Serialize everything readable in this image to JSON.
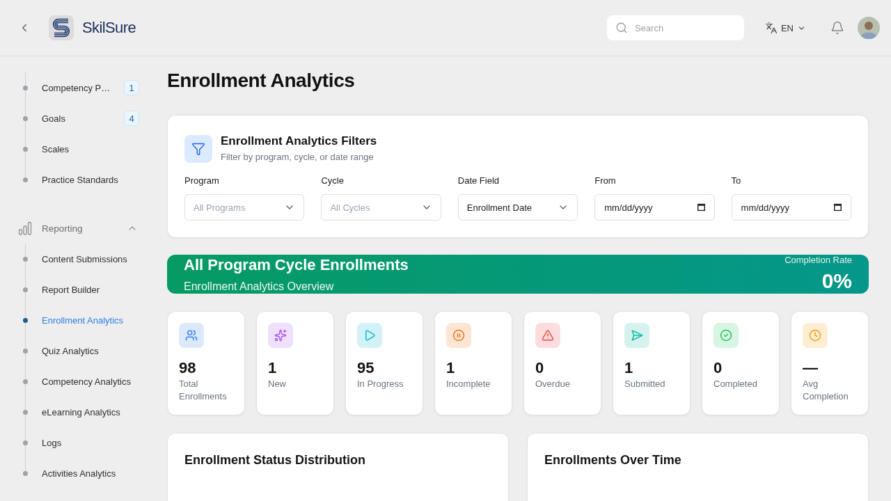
{
  "header": {
    "brand": "SkilSure",
    "search": {
      "placeholder": "Search"
    },
    "language": "EN"
  },
  "sidebar": {
    "groups": [
      {
        "items": [
          {
            "label": "Competency P…",
            "selected": false,
            "badge": "1"
          },
          {
            "label": "Goals",
            "selected": false,
            "badge": "4"
          },
          {
            "label": "Scales",
            "selected": false
          },
          {
            "label": "Practice Standards",
            "selected": false
          }
        ]
      },
      {
        "title": "Reporting",
        "expanded": true,
        "items": [
          {
            "label": "Content Submissions",
            "selected": false
          },
          {
            "label": "Report Builder",
            "selected": false
          },
          {
            "label": "Enrollment Analytics",
            "selected": true
          },
          {
            "label": "Quiz Analytics",
            "selected": false
          },
          {
            "label": "Competency Analytics",
            "selected": false
          },
          {
            "label": "eLearning Analytics",
            "selected": false
          },
          {
            "label": "Logs",
            "selected": false
          },
          {
            "label": "Activities Analytics",
            "selected": false
          }
        ]
      }
    ]
  },
  "page_title": "Enrollment Analytics",
  "filters": {
    "title": "Enrollment Analytics Filters",
    "subtitle": "Filter by program, cycle, or date range",
    "fields": [
      {
        "kind": "select",
        "label": "Program",
        "placeholder": "All Programs"
      },
      {
        "kind": "select",
        "label": "Cycle",
        "placeholder": "All Cycles"
      },
      {
        "kind": "select",
        "label": "Date Field",
        "value": "Enrollment Date"
      },
      {
        "kind": "date",
        "label": "From",
        "placeholder": "mm/dd/yyyy"
      },
      {
        "kind": "date",
        "label": "To",
        "placeholder": "mm/dd/yyyy"
      }
    ]
  },
  "banner": {
    "title": "All Program Cycle Enrollments",
    "subtitle": "Enrollment Analytics Overview",
    "rate_label": "Completion Rate",
    "rate_value": "0%"
  },
  "stats": [
    {
      "kind": "total",
      "value": "98",
      "label": "Total Enrollments",
      "color": "#3b82f6"
    },
    {
      "kind": "new",
      "value": "1",
      "label": "New",
      "color": "#a855f7"
    },
    {
      "kind": "in_progress",
      "value": "95",
      "label": "In Progress",
      "color": "#06b6d4"
    },
    {
      "kind": "incomplete",
      "value": "1",
      "label": "Incomplete",
      "color": "#f97316"
    },
    {
      "kind": "overdue",
      "value": "0",
      "label": "Overdue",
      "color": "#ef4444"
    },
    {
      "kind": "submitted",
      "value": "1",
      "label": "Submitted",
      "color": "#14b8a6"
    },
    {
      "kind": "completed",
      "value": "0",
      "label": "Completed",
      "color": "#22c55e"
    },
    {
      "kind": "average",
      "value": "—",
      "label": "Avg Completion",
      "color": "#f59e0b"
    }
  ],
  "panels": [
    {
      "title": "Enrollment Status Distribution"
    },
    {
      "title": "Enrollments Over Time"
    }
  ]
}
